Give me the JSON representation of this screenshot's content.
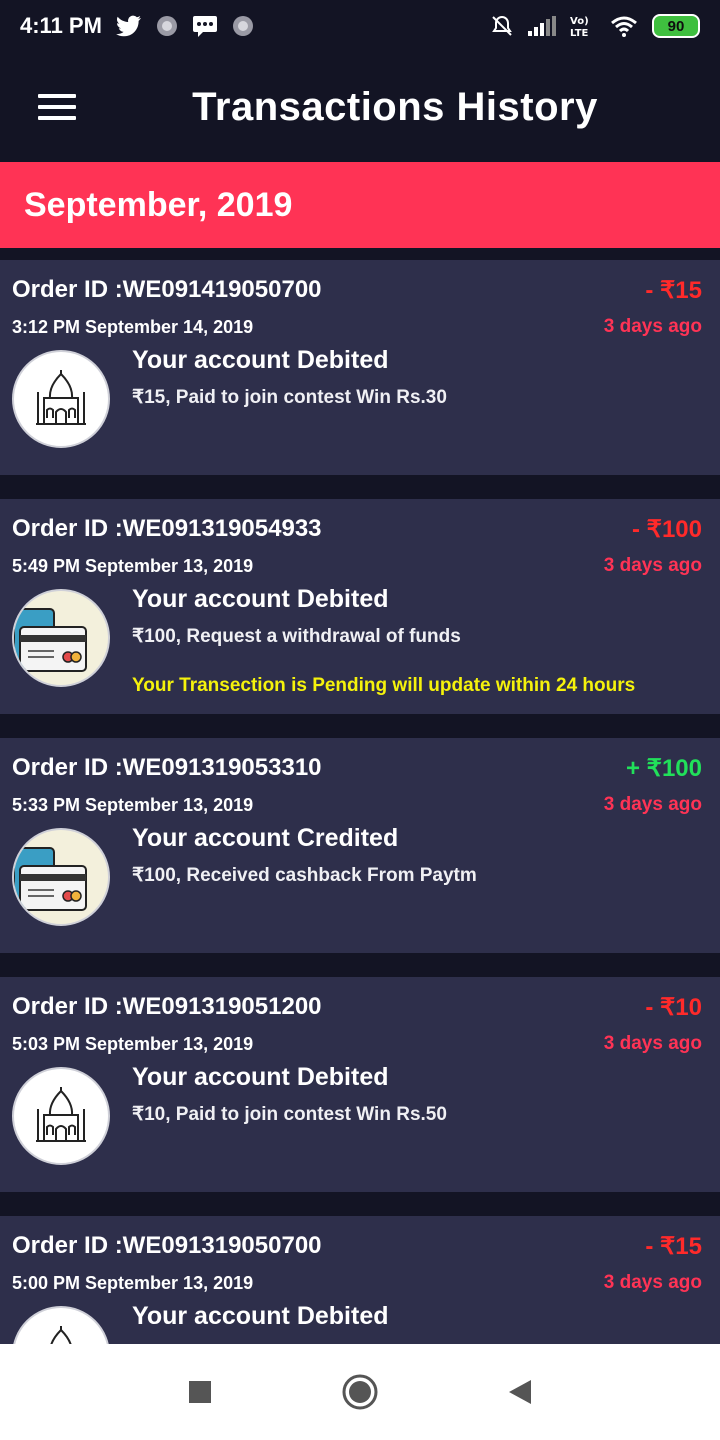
{
  "status_bar": {
    "time": "4:11 PM",
    "battery": "90",
    "icons": [
      "twitter-icon",
      "app-icon",
      "message-icon",
      "app-icon",
      "mute-icon",
      "signal-icon",
      "volte-icon",
      "wifi-icon",
      "battery-icon"
    ]
  },
  "app_bar": {
    "title": "Transactions History",
    "menu_icon": "hamburger-menu-icon"
  },
  "month_header": "September, 2019",
  "colors": {
    "background": "#131424",
    "card": "#2e2f4b",
    "accent": "#ff3355",
    "debit": "#ff2a2a",
    "credit": "#21e05a",
    "pending": "#f5f20c"
  },
  "transactions": [
    {
      "order_id": "Order ID :WE091419050700",
      "amount": "- ₹15",
      "datetime": "3:12 PM September 14, 2019",
      "ago": "3 days ago",
      "title": "Your account Debited",
      "description": "₹15, Paid to join contest Win Rs.30",
      "pending": "",
      "icon": "taj-mahal-icon",
      "type": "debit"
    },
    {
      "order_id": "Order ID :WE091319054933",
      "amount": "- ₹100",
      "datetime": "5:49 PM September 13, 2019",
      "ago": "3 days ago",
      "title": "Your account Debited",
      "description": "₹100, Request a withdrawal of funds",
      "pending": "Your Transection is Pending will update within 24 hours",
      "icon": "card-wallet-icon",
      "type": "debit"
    },
    {
      "order_id": "Order ID :WE091319053310",
      "amount": "+ ₹100",
      "datetime": "5:33 PM September 13, 2019",
      "ago": "3 days ago",
      "title": "Your account Credited",
      "description": "₹100, Received cashback From Paytm",
      "pending": "",
      "icon": "card-wallet-icon",
      "type": "credit"
    },
    {
      "order_id": "Order ID :WE091319051200",
      "amount": "- ₹10",
      "datetime": "5:03 PM September 13, 2019",
      "ago": "3 days ago",
      "title": "Your account Debited",
      "description": "₹10, Paid to join contest Win Rs.50",
      "pending": "",
      "icon": "taj-mahal-icon",
      "type": "debit"
    },
    {
      "order_id": "Order ID :WE091319050700",
      "amount": "- ₹15",
      "datetime": "5:00 PM September 13, 2019",
      "ago": "3 days ago",
      "title": "Your account Debited",
      "description": "",
      "pending": "",
      "icon": "taj-mahal-icon",
      "type": "debit"
    }
  ],
  "nav_bar": {
    "icons": [
      "recent-apps-icon",
      "home-icon",
      "back-icon"
    ]
  }
}
